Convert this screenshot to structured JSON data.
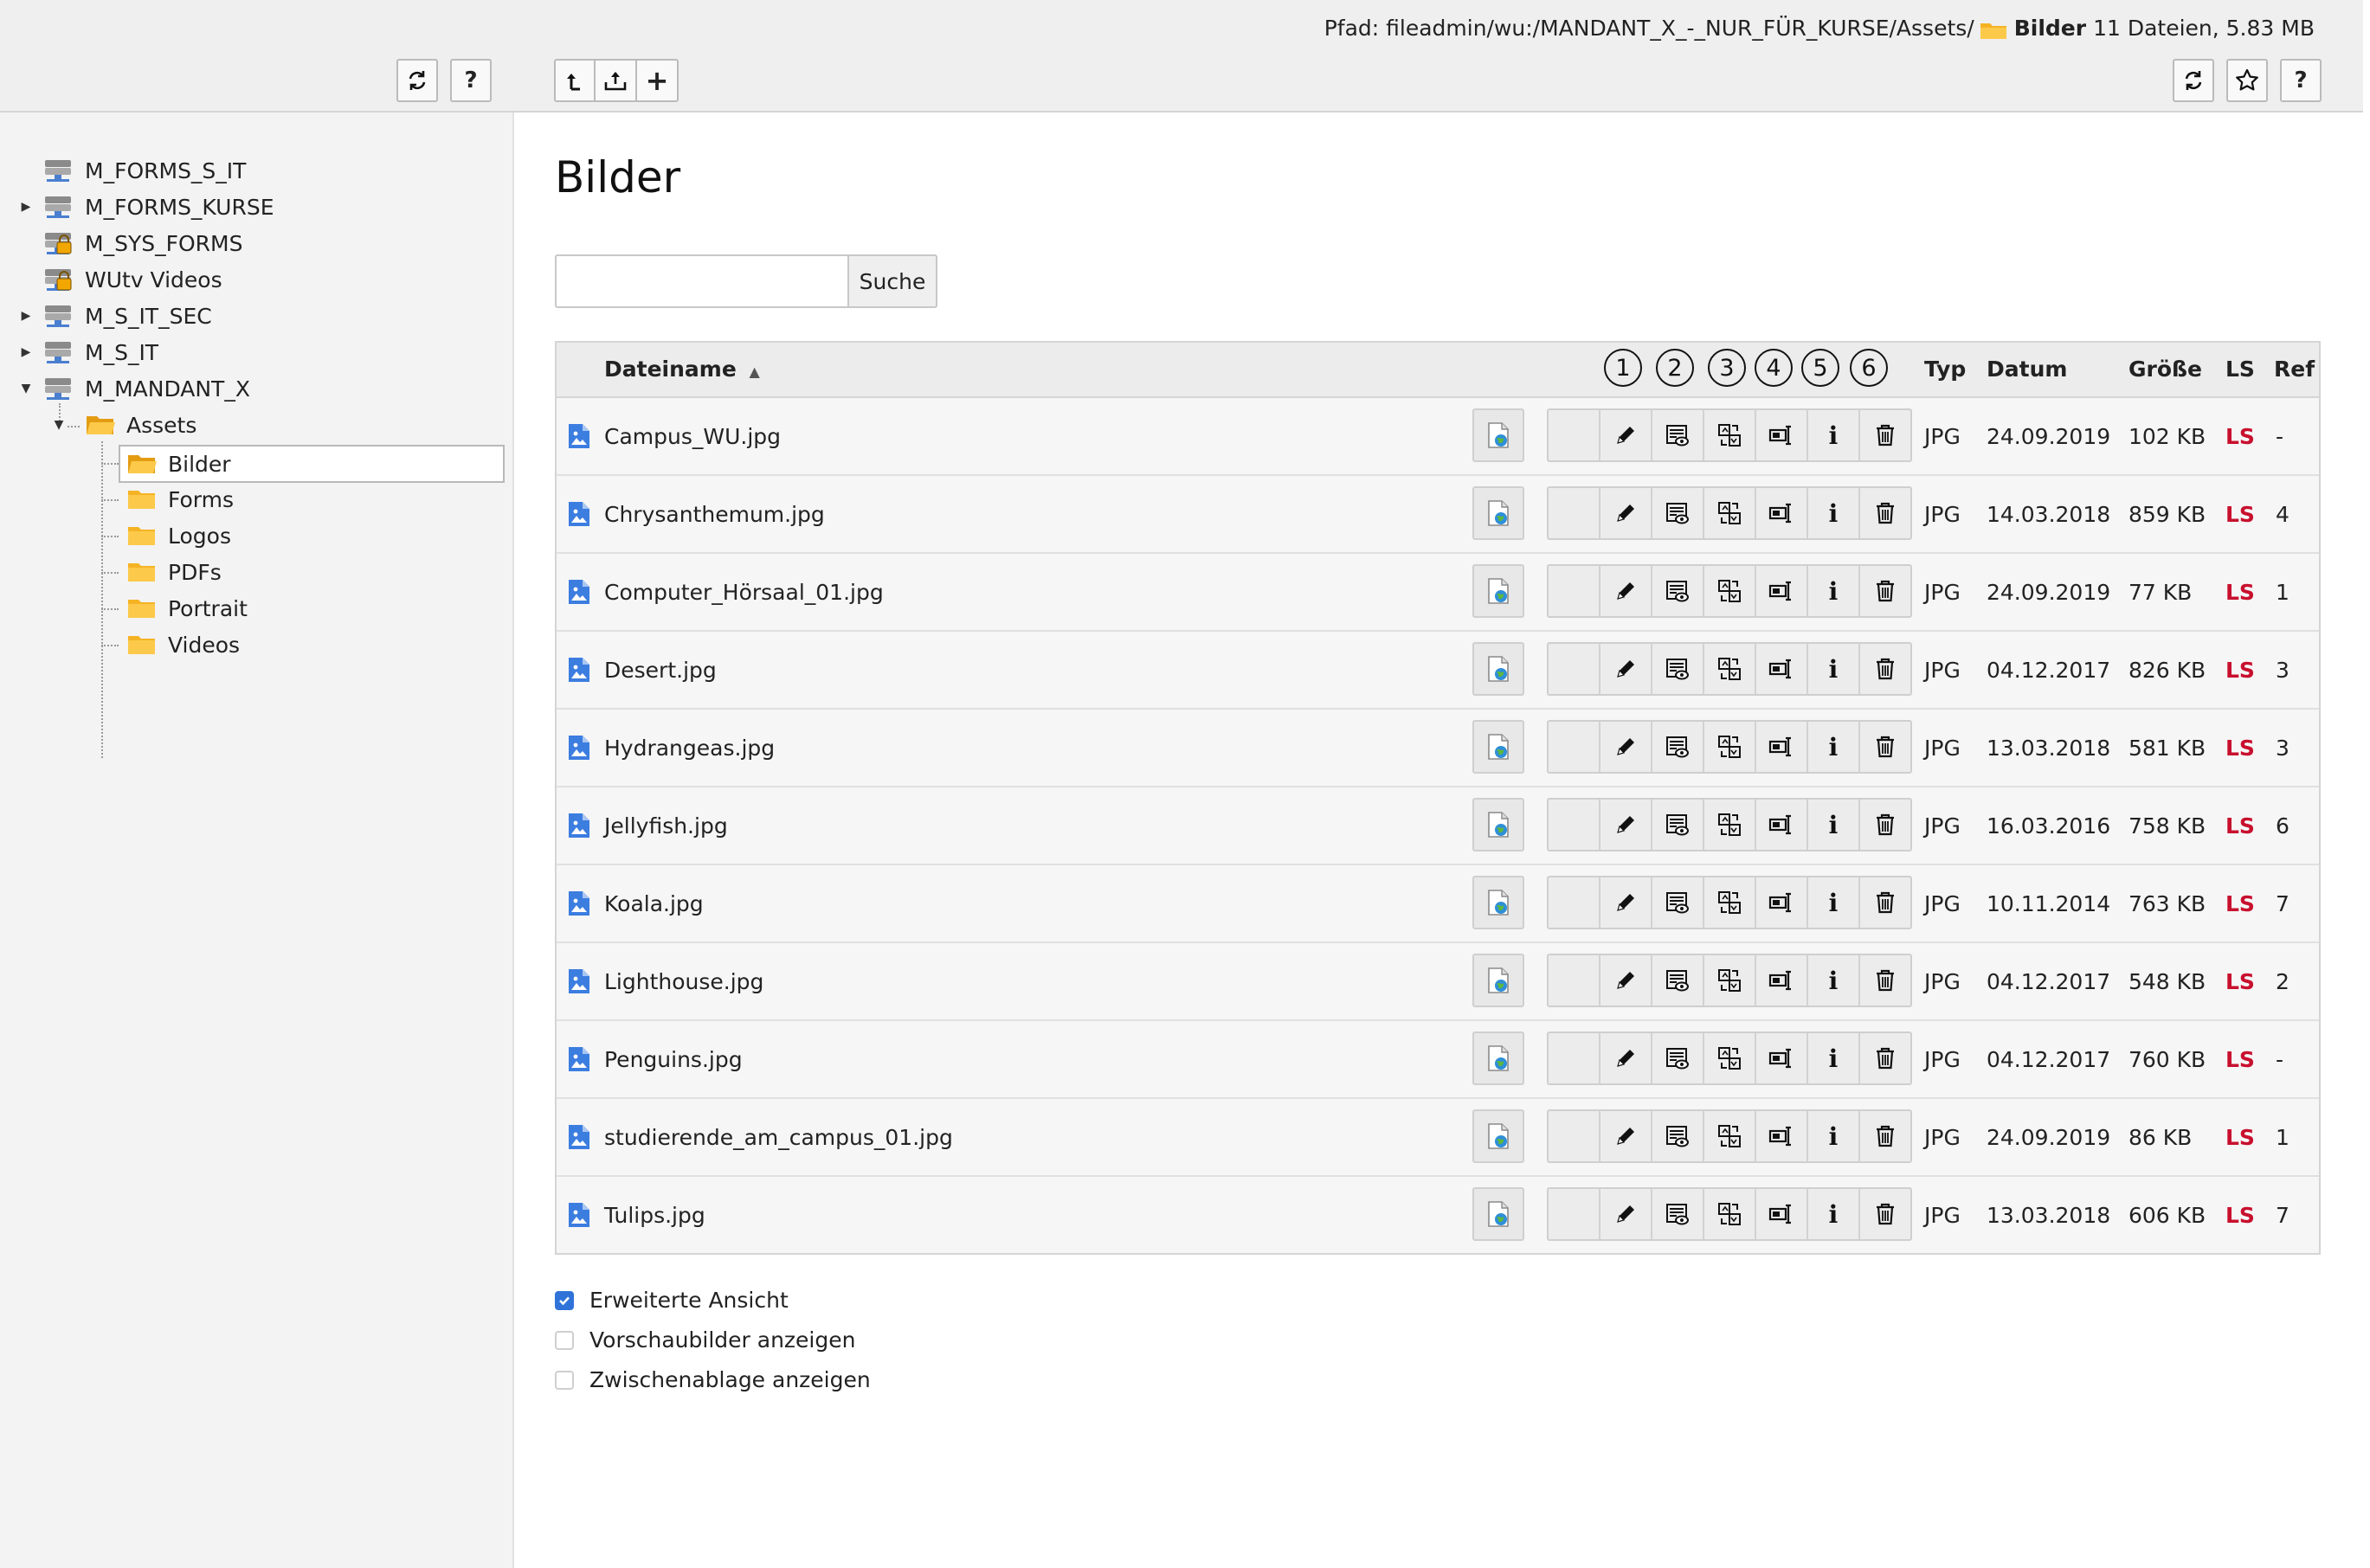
{
  "header": {
    "path_label": "Pfad:",
    "path_value": "fileadmin/wu:/MANDANT_X_-_NUR_FÜR_KURSE/Assets/",
    "current_folder": "Bilder",
    "summary": "11 Dateien, 5.83 MB",
    "left_buttons": [
      {
        "name": "refresh-tree-button",
        "icon": "refresh-icon"
      },
      {
        "name": "help-tree-button",
        "label": "?"
      }
    ],
    "mid_buttons": [
      {
        "name": "folder-up-button",
        "icon": "arrow-up-icon"
      },
      {
        "name": "upload-button",
        "icon": "upload-icon"
      },
      {
        "name": "new-button",
        "label": "+"
      }
    ],
    "right_buttons": [
      {
        "name": "refresh-button",
        "icon": "refresh-icon"
      },
      {
        "name": "bookmark-button",
        "icon": "star-icon"
      },
      {
        "name": "help-button",
        "label": "?"
      }
    ]
  },
  "tree": {
    "items": [
      {
        "label": "M_FORMS_S_IT",
        "icon": "storage-icon",
        "expander": ""
      },
      {
        "label": "M_FORMS_KURSE",
        "icon": "storage-icon",
        "expander": "▶"
      },
      {
        "label": "M_SYS_FORMS",
        "icon": "storage-locked-icon",
        "expander": ""
      },
      {
        "label": "WUtv Videos",
        "icon": "storage-locked-icon",
        "expander": ""
      },
      {
        "label": "M_S_IT_SEC",
        "icon": "storage-icon",
        "expander": "▶"
      },
      {
        "label": "M_S_IT",
        "icon": "storage-icon",
        "expander": "▶"
      },
      {
        "label": "M_MANDANT_X",
        "icon": "storage-icon",
        "expander": "▼"
      }
    ],
    "assets": {
      "label": "Assets",
      "expander": "▼"
    },
    "subfolders": [
      "Bilder",
      "Forms",
      "Logos",
      "PDFs",
      "Portrait",
      "Videos"
    ],
    "selected": "Bilder"
  },
  "main": {
    "title": "Bilder",
    "search": {
      "value": "",
      "button_label": "Suche"
    },
    "table": {
      "headers": {
        "name": "Dateiname",
        "sort_indicator": "▲",
        "action_numbers": [
          "1",
          "2",
          "3",
          "4",
          "5",
          "6"
        ],
        "type": "Typ",
        "date": "Datum",
        "size": "Größe",
        "ls": "LS",
        "ref": "Ref"
      },
      "action_labels": [
        "",
        "",
        "",
        "",
        "i",
        ""
      ],
      "rows": [
        {
          "name": "Campus_WU.jpg",
          "type": "JPG",
          "date": "24.09.2019",
          "size": "102 KB",
          "ls": "LS",
          "ref": "-"
        },
        {
          "name": "Chrysanthemum.jpg",
          "type": "JPG",
          "date": "14.03.2018",
          "size": "859 KB",
          "ls": "LS",
          "ref": "4"
        },
        {
          "name": "Computer_Hörsaal_01.jpg",
          "type": "JPG",
          "date": "24.09.2019",
          "size": "77 KB",
          "ls": "LS",
          "ref": "1"
        },
        {
          "name": "Desert.jpg",
          "type": "JPG",
          "date": "04.12.2017",
          "size": "826 KB",
          "ls": "LS",
          "ref": "3"
        },
        {
          "name": "Hydrangeas.jpg",
          "type": "JPG",
          "date": "13.03.2018",
          "size": "581 KB",
          "ls": "LS",
          "ref": "3"
        },
        {
          "name": "Jellyfish.jpg",
          "type": "JPG",
          "date": "16.03.2016",
          "size": "758 KB",
          "ls": "LS",
          "ref": "6"
        },
        {
          "name": "Koala.jpg",
          "type": "JPG",
          "date": "10.11.2014",
          "size": "763 KB",
          "ls": "LS",
          "ref": "7"
        },
        {
          "name": "Lighthouse.jpg",
          "type": "JPG",
          "date": "04.12.2017",
          "size": "548 KB",
          "ls": "LS",
          "ref": "2"
        },
        {
          "name": "Penguins.jpg",
          "type": "JPG",
          "date": "04.12.2017",
          "size": "760 KB",
          "ls": "LS",
          "ref": "-"
        },
        {
          "name": "studierende_am_campus_01.jpg",
          "type": "JPG",
          "date": "24.09.2019",
          "size": "86 KB",
          "ls": "LS",
          "ref": "1"
        },
        {
          "name": "Tulips.jpg",
          "type": "JPG",
          "date": "13.03.2018",
          "size": "606 KB",
          "ls": "LS",
          "ref": "7"
        }
      ]
    },
    "options": [
      {
        "label": "Erweiterte Ansicht",
        "checked": true
      },
      {
        "label": "Vorschaubilder anzeigen",
        "checked": false
      },
      {
        "label": "Zwischenablage anzeigen",
        "checked": false
      }
    ]
  },
  "colors": {
    "accent_blue": "#2f73d9",
    "ls_red": "#c8102e",
    "folder_yellow": "#f5b324"
  }
}
